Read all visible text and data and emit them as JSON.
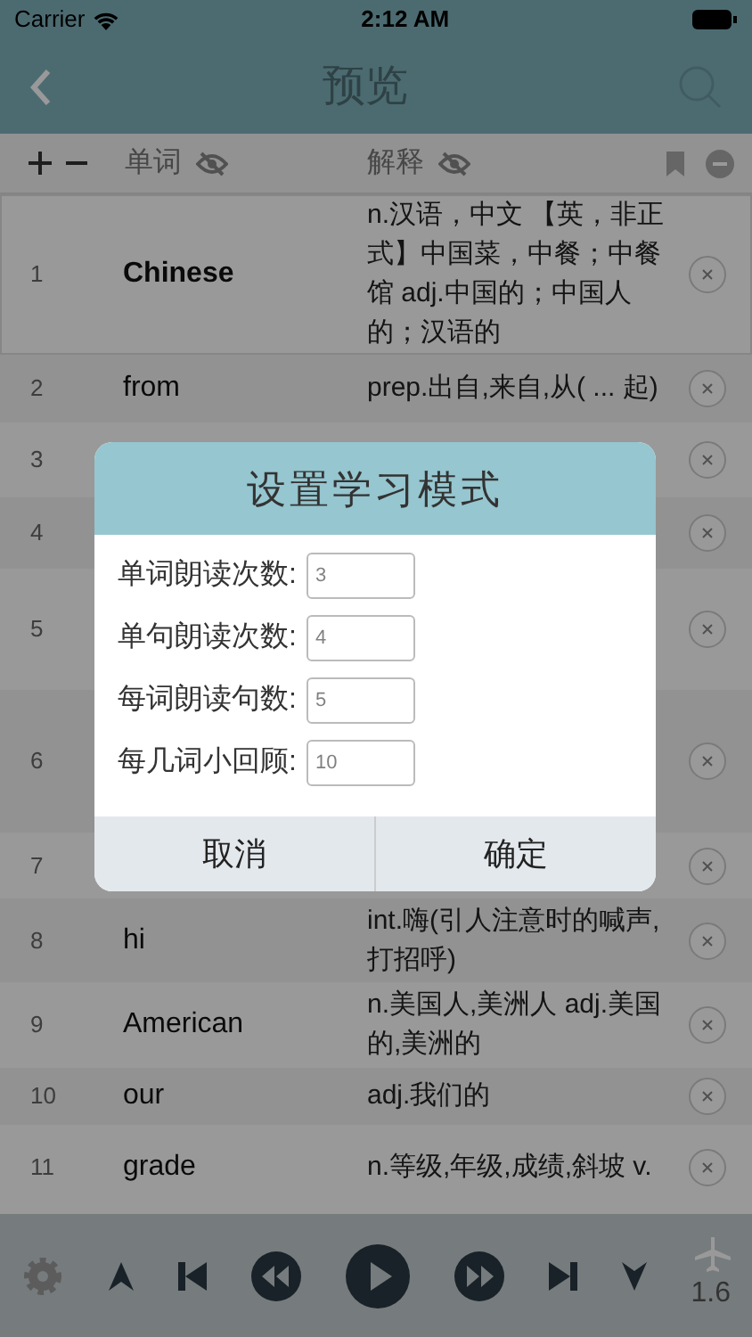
{
  "status_bar": {
    "carrier": "Carrier",
    "time": "2:12 AM"
  },
  "nav": {
    "title": "预览"
  },
  "columns": {
    "word": "单词",
    "definition": "解释"
  },
  "rows": [
    {
      "index": "1",
      "word": "Chinese",
      "definition": "n.汉语，中文 【英，非正式】中国菜，中餐；中餐馆 adj.中国的；中国人的；汉语的",
      "selected": true
    },
    {
      "index": "2",
      "word": "from",
      "definition": "prep.出自,来自,从( ... 起)",
      "selected": false
    },
    {
      "index": "3",
      "selected": false
    },
    {
      "index": "4",
      "selected": false
    },
    {
      "index": "5",
      "selected": false
    },
    {
      "index": "6",
      "selected": false
    },
    {
      "index": "7",
      "selected": false
    },
    {
      "index": "8",
      "word": "hi",
      "definition": "int.嗨(引人注意时的喊声,打招呼)",
      "selected": false
    },
    {
      "index": "9",
      "word": "American",
      "definition": "n.美国人,美洲人 adj.美国的,美洲的",
      "selected": false
    },
    {
      "index": "10",
      "word": "our",
      "definition": "adj.我们的",
      "selected": false
    },
    {
      "index": "11",
      "word": "grade",
      "definition": "n.等级,年级,成绩,斜坡 v.",
      "selected": false
    }
  ],
  "player": {
    "speed": "1.6"
  },
  "dialog": {
    "title": "设置学习模式",
    "fields": [
      {
        "label": "单词朗读次数:",
        "placeholder": "3"
      },
      {
        "label": "单句朗读次数:",
        "placeholder": "4"
      },
      {
        "label": "每词朗读句数:",
        "placeholder": "5"
      },
      {
        "label": "每几词小回顾:",
        "placeholder": "10"
      }
    ],
    "buttons": [
      "取消",
      "确定"
    ]
  }
}
